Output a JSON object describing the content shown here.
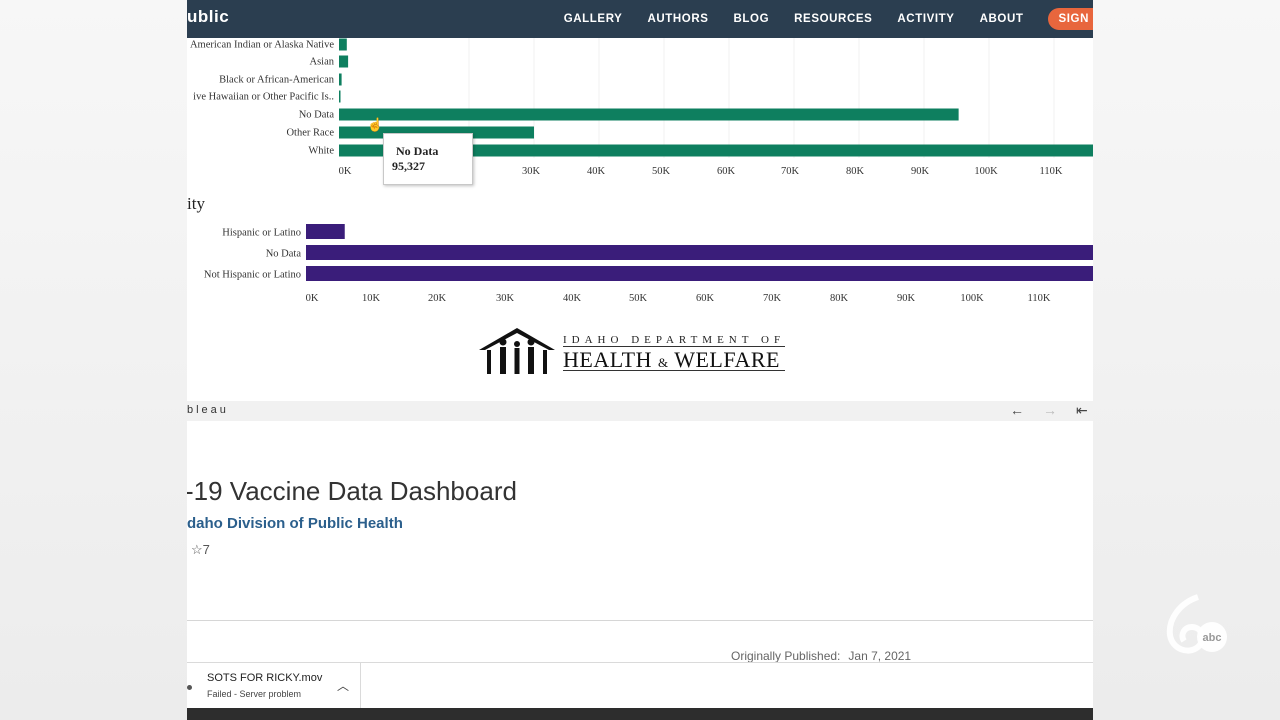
{
  "nav": {
    "brand": "ublic",
    "links": [
      "GALLERY",
      "AUTHORS",
      "BLOG",
      "RESOURCES",
      "ACTIVITY",
      "ABOUT"
    ],
    "signin": "SIGN"
  },
  "chart_data": [
    {
      "type": "bar",
      "orientation": "horizontal",
      "categories": [
        "American Indian or Alaska Native",
        "Asian",
        "Black or African-American",
        "ive Hawaiian or Other Pacific Is..",
        "No Data",
        "Other Race",
        "White"
      ],
      "values": [
        1200,
        1400,
        400,
        200,
        95327,
        30000,
        118000
      ],
      "x_ticks": [
        "0K",
        "30K",
        "40K",
        "50K",
        "60K",
        "70K",
        "80K",
        "90K",
        "100K",
        "110K"
      ],
      "xlim": [
        0,
        116500
      ],
      "color": "#0e7f5f",
      "tooltip": {
        "label": "No Data",
        "value": "95,327"
      }
    },
    {
      "type": "bar",
      "orientation": "horizontal",
      "title": "ity",
      "categories": [
        "Hispanic or Latino",
        "No Data",
        "Not Hispanic or Latino"
      ],
      "values": [
        5800,
        118000,
        118000
      ],
      "x_ticks": [
        "0K",
        "10K",
        "20K",
        "30K",
        "40K",
        "50K",
        "60K",
        "70K",
        "80K",
        "90K",
        "100K",
        "110K"
      ],
      "xlim": [
        0,
        118000
      ],
      "color": "#3a1d7a"
    }
  ],
  "logo": {
    "line1": "IDAHO DEPARTMENT OF",
    "line2_a": "HEALTH",
    "line2_amp": "&",
    "line2_b": "WELFARE"
  },
  "toolbar": {
    "word": "bleau",
    "back_icon": "←",
    "forward_icon": "→",
    "first_icon": "⇤"
  },
  "dashboard": {
    "title": "-19 Vaccine Data Dashboard",
    "author": "daho Division of Public Health",
    "favorites": "7",
    "published_label": "Originally Published:",
    "published_date": "Jan 7, 2021"
  },
  "download": {
    "filename": "SOTS FOR RICKY.mov",
    "status": "Failed - Server problem"
  },
  "colors": {
    "nav": "#2b3e50",
    "signin": "#e8663d",
    "race_bar": "#0e7f5f",
    "ethnicity_bar": "#3a1d7a",
    "author_link": "#2b5f8c"
  }
}
